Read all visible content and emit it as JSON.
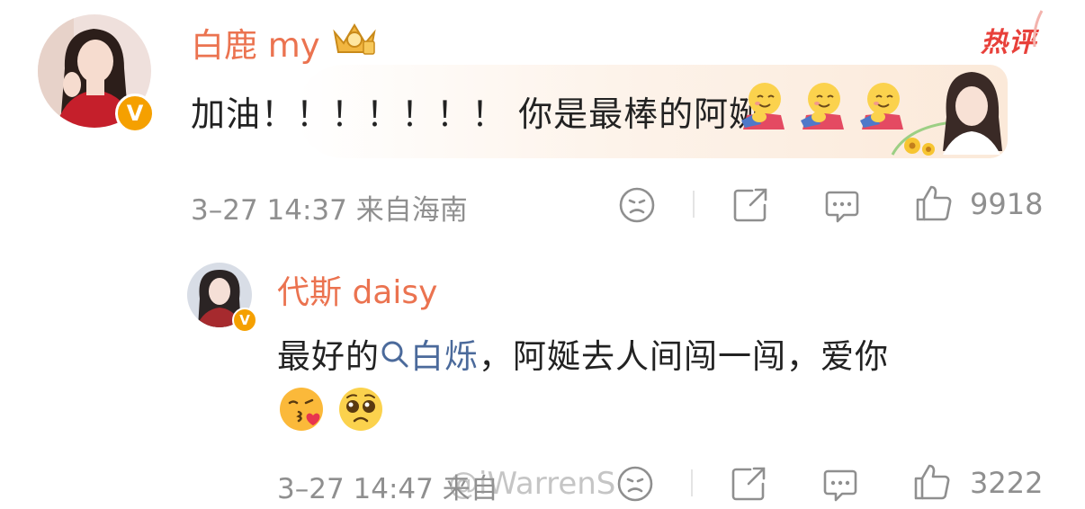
{
  "main_comment": {
    "username": "白鹿 my",
    "hot_label": "热评",
    "text": "加油！！！！！！！ 你是最棒的阿娫",
    "emojis": [
      "hug-emoji",
      "hug-emoji",
      "hug-emoji"
    ],
    "meta": "3–27 14:37 来自海南",
    "like_count": "9918",
    "verified_badge": "V"
  },
  "reply": {
    "username": "代斯 daisy",
    "text_prefix": "最好的",
    "topic": "白烁",
    "text_suffix": "，阿娫去人间闯一闯，爱你",
    "emojis": [
      "kiss-emoji",
      "pleading-emoji"
    ],
    "meta": "3–27 14:47 来自",
    "like_count": "3222",
    "verified_badge": "V"
  },
  "watermark": "@iWarrenS",
  "colors": {
    "username": "#eb7350",
    "hot": "#e8403a",
    "meta": "#8f8f8f",
    "topic": "#4b6a9b",
    "badge": "#f5a000"
  }
}
